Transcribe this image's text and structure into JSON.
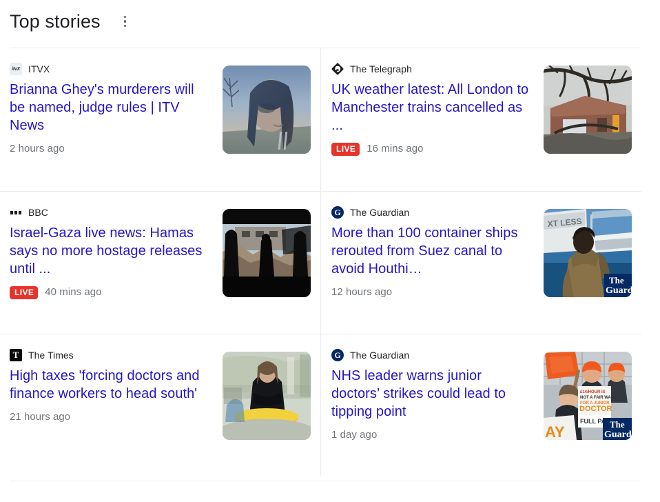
{
  "header": {
    "title": "Top stories",
    "menu_icon": "more-vert-icon"
  },
  "colors": {
    "link": "#2416c7",
    "live_badge": "#e5342a",
    "timestamp": "#70757a",
    "divider": "#ebebeb",
    "guardian_navy": "#052962"
  },
  "stories": {
    "left": [
      {
        "source": "ITVX",
        "source_icon": "itvx-logo-icon",
        "headline": "Brianna Ghey's murderers will be named, judge rules | ITV News",
        "live": false,
        "live_label": "",
        "timestamp": "2 hours ago",
        "thumbnail_alt": "portrait-of-young-woman-outdoors-thumbnail"
      },
      {
        "source": "BBC",
        "source_icon": "bbc-logo-icon",
        "headline": "Israel-Gaza live news: Hamas says no more hostage releases until ...",
        "live": true,
        "live_label": "LIVE",
        "timestamp": "40 mins ago",
        "thumbnail_alt": "silhouette-amid-rubble-thumbnail"
      },
      {
        "source": "The Times",
        "source_icon": "the-times-logo-icon",
        "headline": "High taxes 'forcing doctors and finance workers to head south'",
        "live": false,
        "live_label": "",
        "timestamp": "21 hours ago",
        "thumbnail_alt": "woman-standing-by-yellow-table-thumbnail"
      }
    ],
    "right": [
      {
        "source": "The Telegraph",
        "source_icon": "the-telegraph-logo-icon",
        "headline": "UK weather latest: All London to Manchester trains cancelled as ...",
        "live": true,
        "live_label": "LIVE",
        "timestamp": "16 mins ago",
        "thumbnail_alt": "fallen-tree-on-house-thumbnail"
      },
      {
        "source": "The Guardian",
        "source_icon": "the-guardian-logo-icon",
        "headline": "More than 100 container ships rerouted from Suez canal to avoid Houthi…",
        "live": false,
        "live_label": "",
        "timestamp": "12 hours ago",
        "thumbnail_alt": "person-on-ship-deck-thumbnail"
      },
      {
        "source": "The Guardian",
        "source_icon": "the-guardian-logo-icon",
        "headline": "NHS leader warns junior doctors’ strikes could lead to tipping point",
        "live": false,
        "live_label": "",
        "timestamp": "1 day ago",
        "thumbnail_alt": "junior-doctors-strike-placards-thumbnail"
      }
    ]
  }
}
